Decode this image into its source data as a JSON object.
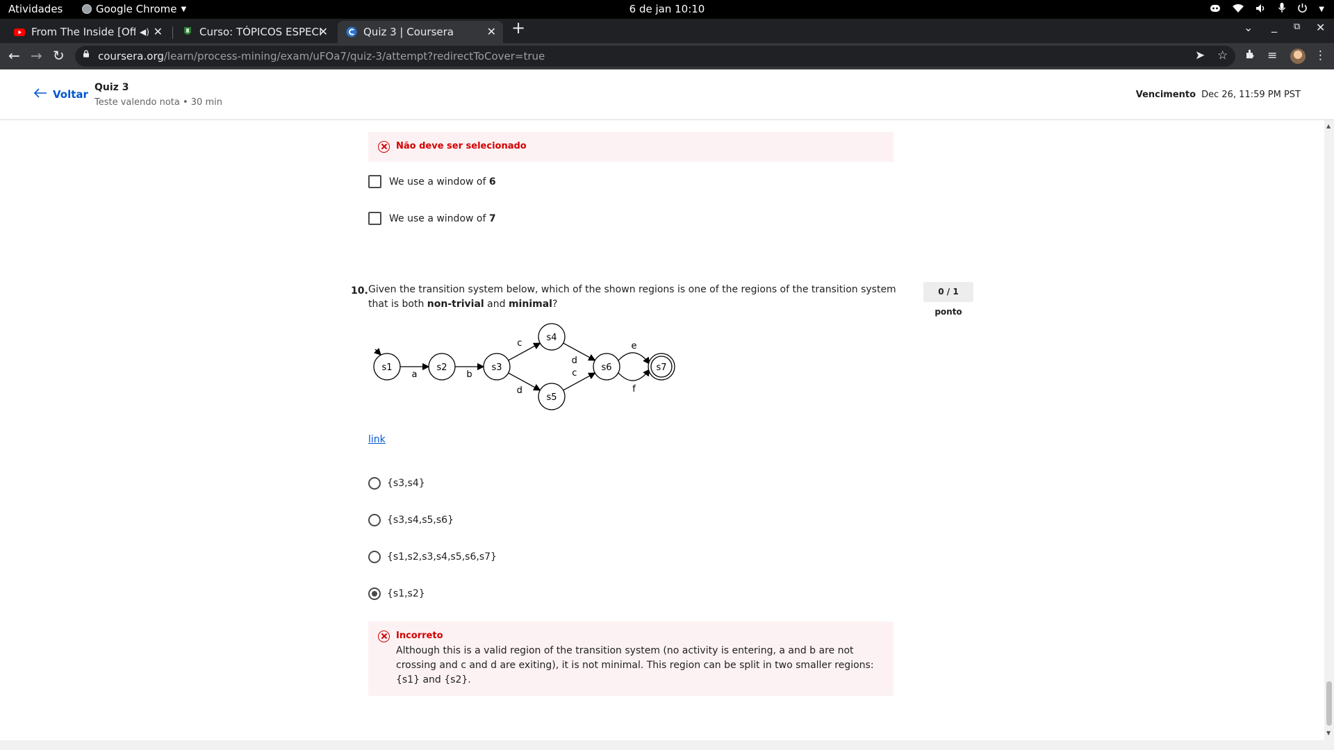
{
  "system_bar": {
    "activities": "Atividades",
    "app_name": "Google Chrome",
    "clock": "6 de jan  10:10"
  },
  "tabs": [
    {
      "title": "From The Inside [Offic",
      "favicon": "youtube-icon"
    },
    {
      "title": "Curso: TÓPICOS ESPECIAI",
      "favicon": "university-icon"
    },
    {
      "title": "Quiz 3 | Coursera",
      "favicon": "coursera-icon"
    }
  ],
  "address_bar": {
    "host": "coursera.org",
    "path": "/learn/process-mining/exam/uFOa7/quiz-3/attempt?redirectToCover=true"
  },
  "header": {
    "back_label": "Voltar",
    "quiz_title": "Quiz 3",
    "quiz_subtitle": "Teste valendo nota • 30 min",
    "due_label": "Vencimento",
    "due_value": "Dec 26, 11:59 PM PST"
  },
  "previous_question": {
    "feedback": "Não deve ser selecionado",
    "options": [
      {
        "prefix": "We use a window of ",
        "value": "6"
      },
      {
        "prefix": "We use a window of ",
        "value": "7"
      }
    ]
  },
  "question": {
    "number": "10.",
    "text_1": "Given the transition system below, which of the shown regions is one of the regions of the transition system that is both ",
    "bold_1": "non-trivial",
    "text_2": " and ",
    "bold_2": "minimal",
    "text_3": "?",
    "points": "0 / 1 ponto",
    "link_label": "link",
    "options": [
      "{s3,s4}",
      "{s3,s4,s5,s6}",
      "{s1,s2,s3,s4,s5,s6,s7}",
      "{s1,s2}"
    ],
    "selected_index": 3,
    "feedback_title": "Incorreto",
    "feedback_text": "Although this is a valid region of the transition system (no activity is entering, a and b are not crossing and c and d are exiting), it is not minimal. This region can be split in two smaller regions: {s1} and {s2}."
  },
  "transition_system": {
    "states": [
      "s1",
      "s2",
      "s3",
      "s4",
      "s5",
      "s6",
      "s7"
    ],
    "transitions": [
      {
        "from": "s1",
        "to": "s2",
        "label": "a"
      },
      {
        "from": "s2",
        "to": "s3",
        "label": "b"
      },
      {
        "from": "s3",
        "to": "s4",
        "label": "c"
      },
      {
        "from": "s3",
        "to": "s5",
        "label": "d"
      },
      {
        "from": "s4",
        "to": "s6",
        "label": "d"
      },
      {
        "from": "s5",
        "to": "s6",
        "label": "c"
      },
      {
        "from": "s6",
        "to": "s7",
        "label": "e"
      },
      {
        "from": "s6",
        "to": "s7",
        "label": "f"
      }
    ],
    "initial": "s1",
    "final": "s7"
  }
}
